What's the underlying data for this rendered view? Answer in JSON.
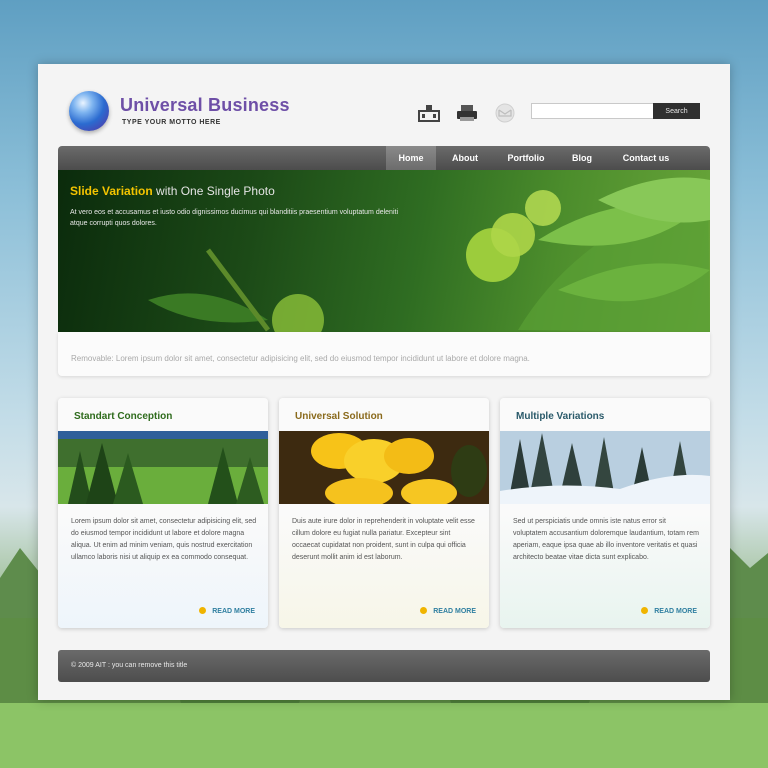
{
  "brand": {
    "title": "Universal Business",
    "motto": "TYPE YOUR MOTTO HERE"
  },
  "header_icons": [
    "home-icon",
    "print-icon",
    "mail-icon"
  ],
  "search": {
    "value": "",
    "placeholder": "",
    "button_label": "Search"
  },
  "nav": {
    "items": [
      "Home",
      "About",
      "Portfolio",
      "Blog",
      "Contact us"
    ],
    "active": "Home"
  },
  "slider": {
    "title_highlight": "Slide Variation",
    "title_rest": " with One Single Photo",
    "text": "At vero eos et accusamus et iusto odio dignissimos ducimus qui blanditiis praesentium voluptatum deleniti atque corrupti quos dolores.",
    "caption": "Removable: Lorem ipsum dolor sit amet, consectetur adipisicing elit, sed do eiusmod tempor incididunt ut labore et dolore magna."
  },
  "columns": [
    {
      "title": "Standart Conception",
      "title_color": "#2e6b1c",
      "text": "Lorem ipsum dolor sit amet, consectetur adipisicing elit, sed do eiusmod tempor incididunt ut labore et dolore magna aliqua. Ut enim ad minim veniam, quis nostrud exercitation ullamco laboris nisi ut aliquip ex ea commodo consequat.",
      "read_more": "READ MORE"
    },
    {
      "title": "Universal Solution",
      "title_color": "#8a6a1c",
      "text": "Duis aute irure dolor in reprehenderit in voluptate velit esse cillum dolore eu fugiat nulla pariatur. Excepteur sint occaecat cupidatat non proident, sunt in culpa qui officia deserunt mollit anim id est laborum.",
      "read_more": "READ MORE"
    },
    {
      "title": "Multiple Variations",
      "title_color": "#2a5a6a",
      "text": "Sed ut perspiciatis unde omnis iste natus error sit voluptatem accusantium doloremque laudantium, totam rem aperiam, eaque ipsa quae ab illo inventore veritatis et quasi architecto beatae vitae dicta sunt explicabo.",
      "read_more": "READ MORE"
    }
  ],
  "footer": {
    "text": "© 2009 AIT : you can remove this title"
  },
  "colors": {
    "brand_purple": "#6e4fa7",
    "slide_highlight": "#f4c400",
    "read_more": "#2f7fa0",
    "nav_bg": "#575757"
  }
}
